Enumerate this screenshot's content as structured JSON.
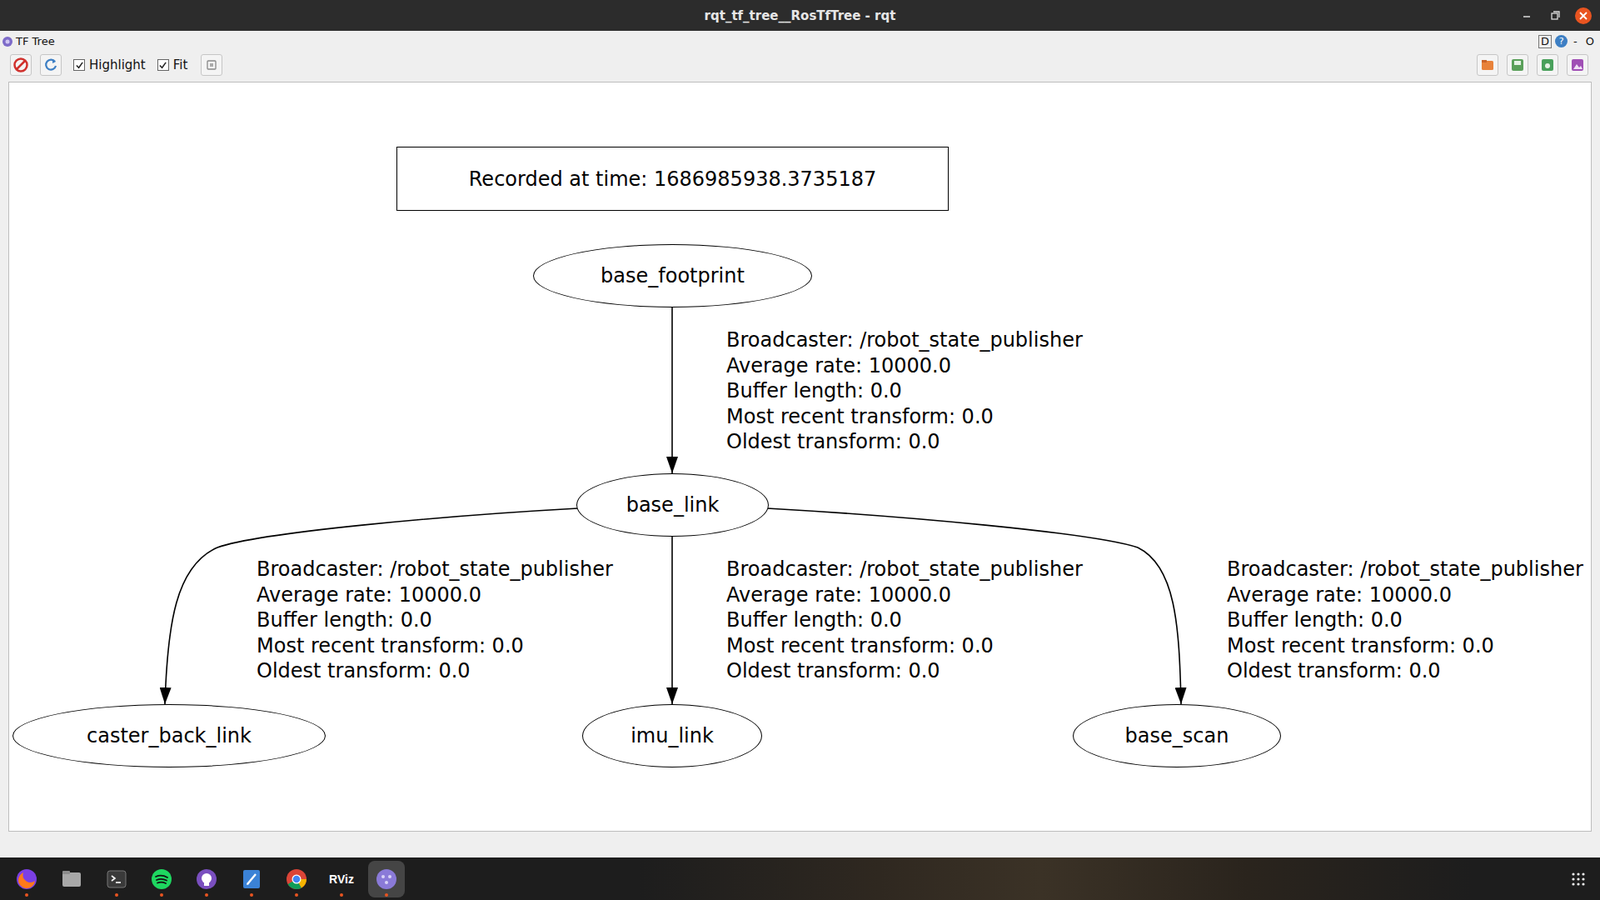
{
  "window": {
    "title": "rqt_tf_tree__RosTfTree - rqt"
  },
  "plugin": {
    "title": "TF Tree",
    "dock": "D",
    "help": "?",
    "controls": [
      "-",
      "O"
    ]
  },
  "toolbar": {
    "checkboxes": [
      {
        "label": "Highlight",
        "checked": true
      },
      {
        "label": "Fit",
        "checked": true
      }
    ]
  },
  "diagram": {
    "recorded": "Recorded at time: 1686985938.3735187",
    "nodes": [
      "base_footprint",
      "base_link",
      "caster_back_link",
      "imu_link",
      "base_scan"
    ],
    "edges": [
      {
        "parent": "base_footprint",
        "child": "base_link",
        "lines": [
          "Broadcaster: /robot_state_publisher",
          "Average rate: 10000.0",
          "Buffer length: 0.0",
          "Most recent transform: 0.0",
          "Oldest transform: 0.0"
        ]
      },
      {
        "parent": "base_link",
        "child": "caster_back_link",
        "lines": [
          "Broadcaster: /robot_state_publisher",
          "Average rate: 10000.0",
          "Buffer length: 0.0",
          "Most recent transform: 0.0",
          "Oldest transform: 0.0"
        ]
      },
      {
        "parent": "base_link",
        "child": "imu_link",
        "lines": [
          "Broadcaster: /robot_state_publisher",
          "Average rate: 10000.0",
          "Buffer length: 0.0",
          "Most recent transform: 0.0",
          "Oldest transform: 0.0"
        ]
      },
      {
        "parent": "base_link",
        "child": "base_scan",
        "lines": [
          "Broadcaster: /robot_state_publisher",
          "Average rate: 10000.0",
          "Buffer length: 0.0",
          "Most recent transform: 0.0",
          "Oldest transform: 0.0"
        ]
      }
    ]
  },
  "taskbar": {
    "apps": [
      {
        "kind": "firefox",
        "running": true,
        "selected": false
      },
      {
        "kind": "files",
        "running": false,
        "selected": false
      },
      {
        "kind": "terminal",
        "running": true,
        "selected": false
      },
      {
        "kind": "spotify",
        "running": true,
        "selected": false
      },
      {
        "kind": "github",
        "running": true,
        "selected": false
      },
      {
        "kind": "editor",
        "running": true,
        "selected": false
      },
      {
        "kind": "chrome",
        "running": true,
        "selected": false
      },
      {
        "kind": "rviz",
        "label": "RViz",
        "running": true,
        "selected": false
      },
      {
        "kind": "rqt",
        "running": true,
        "selected": true
      }
    ]
  }
}
